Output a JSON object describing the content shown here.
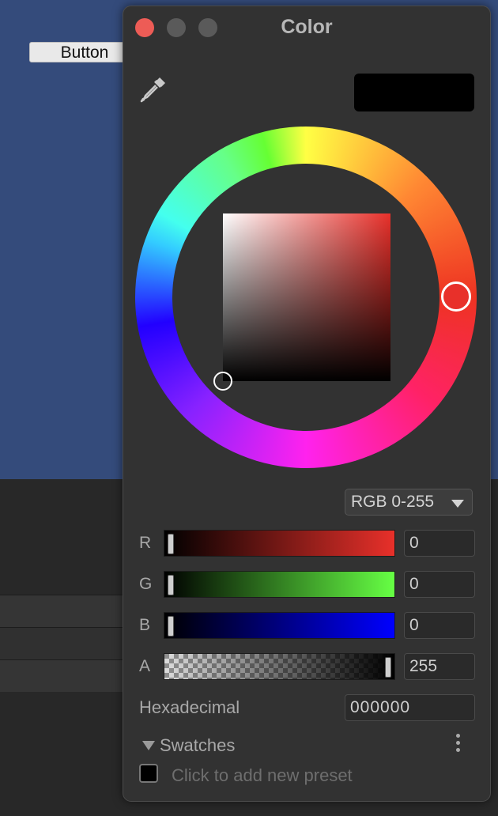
{
  "background": {
    "button_label": "Button"
  },
  "window": {
    "title": "Color",
    "controls": [
      "close",
      "minimize",
      "zoom"
    ]
  },
  "picker": {
    "current_color": "#000000",
    "eyedropper_icon": "eyedropper-icon",
    "hue_color": "#e8302a",
    "mode": "RGB 0-255"
  },
  "channels": [
    {
      "label": "R",
      "value": "0",
      "fraction": 0
    },
    {
      "label": "G",
      "value": "0",
      "fraction": 0
    },
    {
      "label": "B",
      "value": "0",
      "fraction": 0
    },
    {
      "label": "A",
      "value": "255",
      "fraction": 1
    }
  ],
  "hex": {
    "label": "Hexadecimal",
    "value": "000000"
  },
  "swatches": {
    "label": "Swatches",
    "add_preset": "Click to add new preset"
  }
}
